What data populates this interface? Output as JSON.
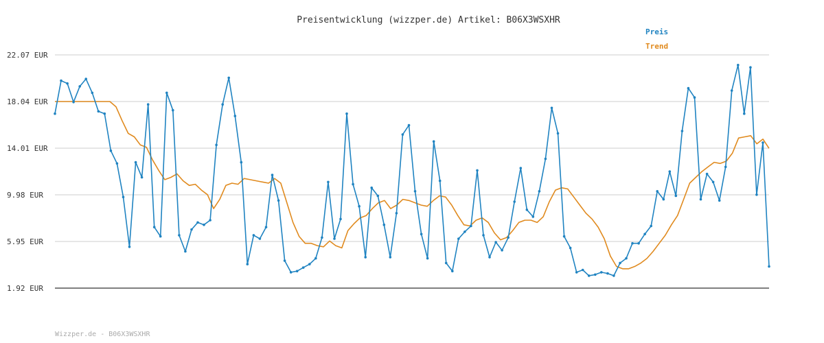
{
  "chart_data": {
    "type": "line",
    "title": "Preisentwicklung (wizzper.de) Artikel: B06X3WSXHR",
    "footer": "Wizzper.de - B06X3WSXHR",
    "ylim": [
      1.92,
      22.07
    ],
    "yticks": [
      "1.92 EUR",
      "5.95 EUR",
      "9.98 EUR",
      "14.01 EUR",
      "18.04 EUR",
      "22.07 EUR"
    ],
    "ytick_values": [
      1.92,
      5.95,
      9.98,
      14.01,
      18.04,
      22.07
    ],
    "grid": true,
    "legend_position": "top-right",
    "colors": {
      "preis": "#1f83c1",
      "trend": "#e08a1e"
    },
    "series": [
      {
        "name": "Preis",
        "values": [
          16.99,
          19.84,
          19.6,
          17.99,
          19.35,
          19.99,
          18.79,
          17.19,
          16.99,
          13.79,
          12.69,
          9.79,
          5.49,
          12.79,
          11.49,
          17.79,
          7.19,
          6.39,
          18.79,
          17.29,
          6.49,
          5.09,
          6.99,
          7.59,
          7.39,
          7.79,
          14.29,
          17.79,
          20.09,
          16.79,
          12.79,
          3.99,
          6.49,
          6.19,
          7.19,
          11.69,
          9.49,
          4.29,
          3.29,
          3.39,
          3.69,
          3.99,
          4.49,
          6.29,
          11.09,
          6.19,
          7.89,
          16.99,
          10.89,
          8.99,
          4.59,
          10.59,
          9.89,
          7.39,
          4.59,
          8.39,
          15.19,
          15.99,
          10.29,
          6.59,
          4.49,
          14.59,
          11.19,
          4.09,
          3.39,
          6.19,
          6.79,
          7.29,
          12.09,
          6.49,
          4.59,
          5.89,
          5.19,
          6.29,
          9.39,
          12.29,
          8.69,
          8.09,
          10.29,
          13.09,
          17.49,
          15.29,
          6.39,
          5.39,
          3.29,
          3.49,
          2.99,
          3.09,
          3.29,
          3.19,
          2.99,
          4.09,
          4.49,
          5.79,
          5.79,
          6.59,
          7.29,
          10.29,
          9.59,
          11.99,
          9.89,
          15.49,
          19.19,
          18.39,
          9.59,
          11.79,
          11.09,
          9.49,
          12.39,
          18.99,
          21.19,
          16.99,
          20.99,
          9.99,
          14.49,
          3.79
        ],
        "x_range": [
          1,
          1200
        ]
      },
      {
        "name": "Trend",
        "values": [
          18.04,
          18.04,
          18.04,
          18.04,
          18.04,
          18.04,
          18.04,
          18.04,
          18.04,
          18.04,
          17.59,
          16.39,
          15.29,
          14.99,
          14.29,
          14.09,
          12.99,
          12.09,
          11.29,
          11.49,
          11.79,
          11.19,
          10.79,
          10.89,
          10.39,
          9.99,
          8.79,
          9.59,
          10.79,
          10.99,
          10.89,
          11.39,
          11.29,
          11.19,
          11.09,
          10.99,
          11.39,
          10.99,
          9.29,
          7.59,
          6.39,
          5.79,
          5.79,
          5.59,
          5.49,
          5.99,
          5.59,
          5.39,
          6.89,
          7.49,
          7.99,
          8.19,
          8.79,
          9.29,
          9.49,
          8.79,
          9.09,
          9.59,
          9.49,
          9.29,
          9.09,
          8.99,
          9.49,
          9.89,
          9.79,
          9.09,
          8.19,
          7.39,
          7.29,
          7.79,
          7.99,
          7.59,
          6.69,
          6.09,
          6.29,
          6.89,
          7.59,
          7.79,
          7.79,
          7.59,
          8.09,
          9.39,
          10.39,
          10.59,
          10.49,
          9.79,
          9.09,
          8.39,
          7.89,
          7.19,
          6.19,
          4.69,
          3.79,
          3.59,
          3.59,
          3.79,
          4.09,
          4.49,
          5.09,
          5.79,
          6.49,
          7.39,
          8.19,
          9.59,
          10.99,
          11.49,
          11.99,
          12.39,
          12.79,
          12.69,
          12.89,
          13.59,
          14.89,
          14.99,
          15.09,
          14.39,
          14.79,
          13.99
        ],
        "x_range": [
          1,
          1200
        ]
      }
    ]
  }
}
